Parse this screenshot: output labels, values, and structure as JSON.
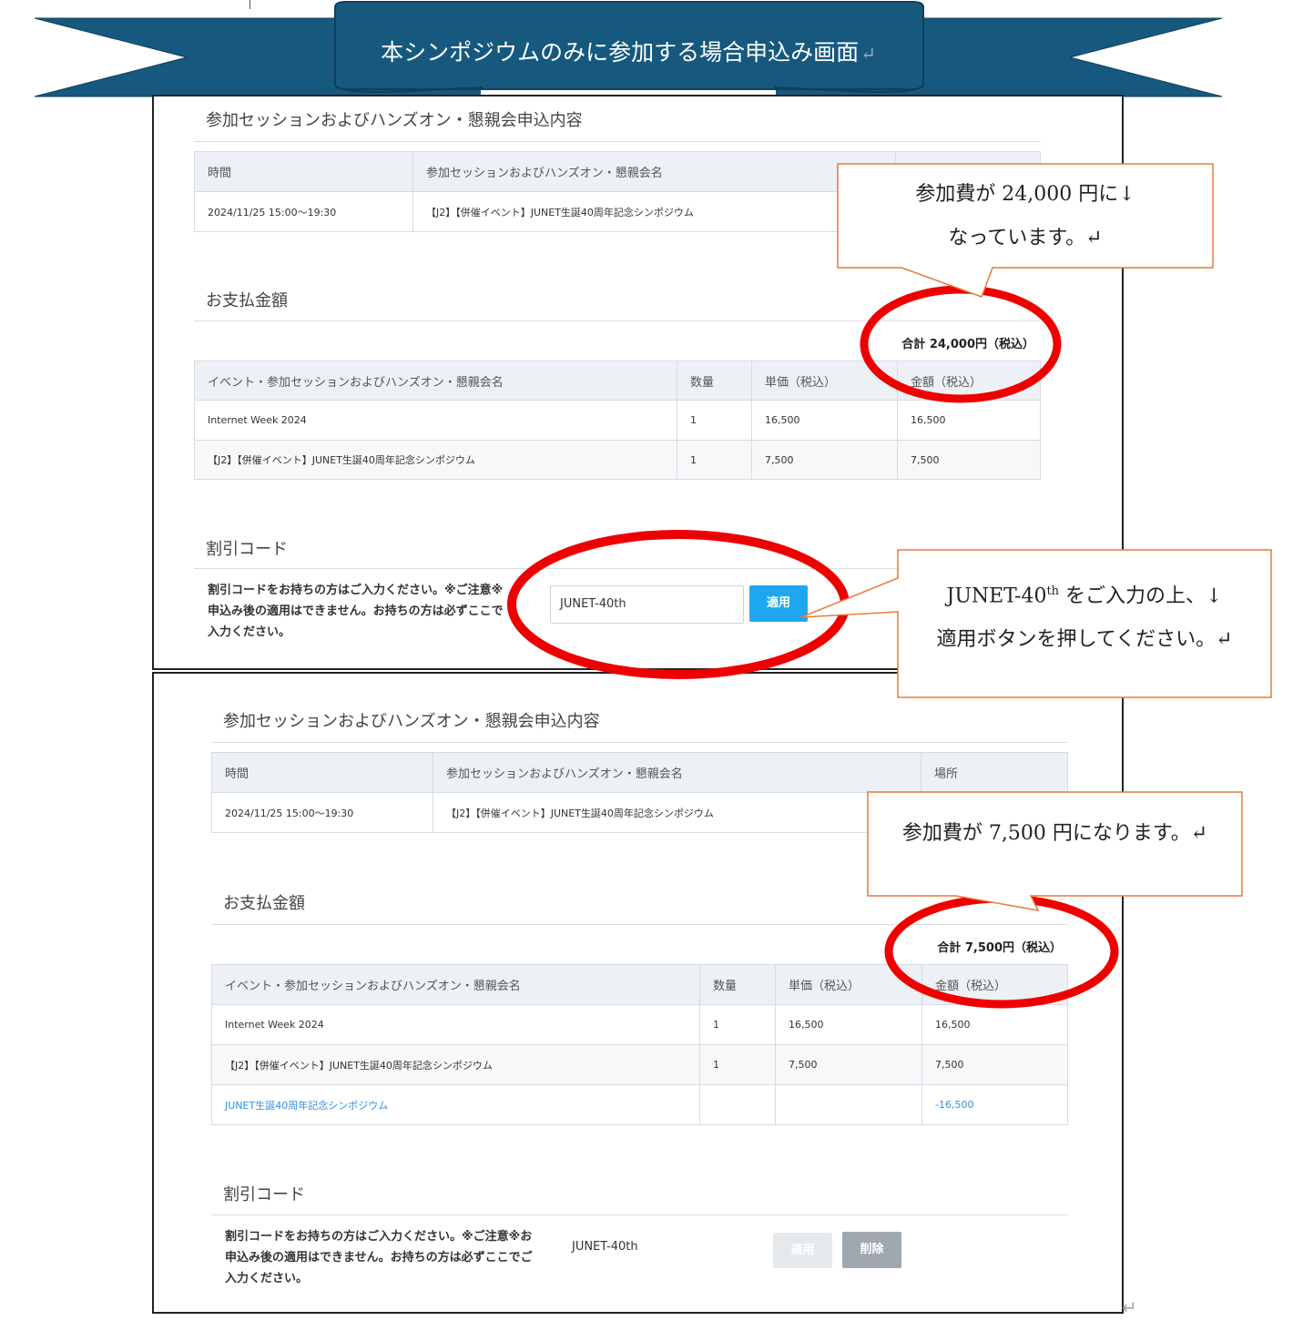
{
  "banner": {
    "title": "本シンポジウムのみに参加する場合申込み画面",
    "return_mark": "↵",
    "color": "#17597e"
  },
  "panel1": {
    "session_title": "参加セッションおよびハンズオン・懇親会申込内容",
    "session_table": {
      "headers": [
        "時間",
        "参加セッションおよびハンズオン・懇親会名",
        ""
      ],
      "rows": [
        [
          "2024/11/25 15:00〜19:30",
          "【J2】【併催イベント】JUNET生誕40周年記念シンポジウム",
          ""
        ]
      ]
    },
    "payment_title": "お支払金額",
    "total": "合計 24,000円（税込）",
    "payment_table": {
      "headers": [
        "イベント・参加セッションおよびハンズオン・懇親会名",
        "数量",
        "単価（税込）",
        "金額（税込）"
      ],
      "rows": [
        [
          "Internet Week 2024",
          "1",
          "16,500",
          "16,500"
        ],
        [
          "【J2】【併催イベント】JUNET生誕40周年記念シンポジウム",
          "1",
          "7,500",
          "7,500"
        ]
      ]
    },
    "discount_title": "割引コード",
    "discount_text": [
      "割引コードをお持ちの方はご入力ください。※ご注意※",
      "申込み後の適用はできません。お持ちの方は必ずここで",
      "入力ください。"
    ],
    "discount_input_value": "JUNET-40th",
    "apply_button": "適用"
  },
  "panel2": {
    "session_title": "参加セッションおよびハンズオン・懇親会申込内容",
    "session_table": {
      "headers": [
        "時間",
        "参加セッションおよびハンズオン・懇親会名",
        "場所"
      ],
      "rows": [
        [
          "2024/11/25 15:00〜19:30",
          "【J2】【併催イベント】JUNET生誕40周年記念シンポジウム",
          ""
        ]
      ]
    },
    "payment_title": "お支払金額",
    "total": "合計 7,500円（税込）",
    "payment_table": {
      "headers": [
        "イベント・参加セッションおよびハンズオン・懇親会名",
        "数量",
        "単価（税込）",
        "金額（税込）"
      ],
      "rows": [
        [
          "Internet Week 2024",
          "1",
          "16,500",
          "16,500"
        ],
        [
          "【J2】【併催イベント】JUNET生誕40周年記念シンポジウム",
          "1",
          "7,500",
          "7,500"
        ],
        [
          "JUNET生誕40周年記念シンポジウム",
          "",
          "",
          "-16,500"
        ]
      ]
    },
    "discount_title": "割引コード",
    "discount_text": [
      "割引コードをお持ちの方はご入力ください。※ご注意※お",
      "申込み後の適用はできません。お持ちの方は必ずここでご",
      "入力ください。"
    ],
    "discount_code_value": "JUNET-40th",
    "apply_button": "適用",
    "delete_button": "削除"
  },
  "callouts": {
    "c1_line1": "参加費が 24,000 円に↓",
    "c1_line2": "なっています。↵",
    "c2_line1_a": "JUNET-40",
    "c2_line1_sup": "th",
    "c2_line1_b": " をご入力の上、↓",
    "c2_line2": "適用ボタンを押してください。↵",
    "c3_line1": "参加費が 7,500 円になります。↵"
  },
  "page_return_mark": "↵",
  "colors": {
    "highlight_ring": "#ee0000",
    "callout_border": "#e8793a",
    "apply_button": "#1ea7f0",
    "discount_link": "#2d8fe6"
  }
}
